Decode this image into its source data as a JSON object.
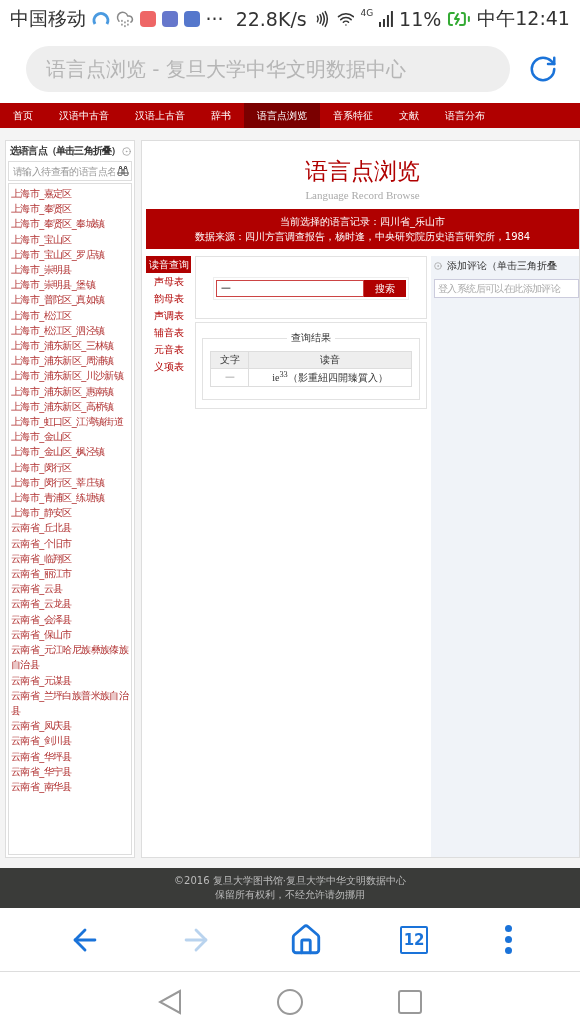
{
  "status_bar": {
    "carrier": "中国移动",
    "more": "···",
    "speed": "22.8K/s",
    "network": "4G",
    "battery": "11%",
    "time": "中午12:41"
  },
  "address_bar": {
    "title": "语言点浏览 - 复旦大学中华文明数据中心"
  },
  "nav": [
    {
      "label": "首页",
      "selected": false
    },
    {
      "label": "汉语中古音",
      "selected": false
    },
    {
      "label": "汉语上古音",
      "selected": false
    },
    {
      "label": "辞书",
      "selected": false
    },
    {
      "label": "语言点浏览",
      "selected": true
    },
    {
      "label": "音系特征",
      "selected": false
    },
    {
      "label": "文献",
      "selected": false
    },
    {
      "label": "语言分布",
      "selected": false
    }
  ],
  "sidebar": {
    "title": "选语言点（单击三角折叠）",
    "search_placeholder": "请输入待查看的语言点名",
    "items": [
      "上海市_嘉定区",
      "上海市_奉贤区",
      "上海市_奉贤区_奉城镇",
      "上海市_宝山区",
      "上海市_宝山区_罗店镇",
      "上海市_崇明县",
      "上海市_崇明县_堡镇",
      "上海市_普陀区_真如镇",
      "上海市_松江区",
      "上海市_松江区_泗泾镇",
      "上海市_浦东新区_三林镇",
      "上海市_浦东新区_周浦镇",
      "上海市_浦东新区_川沙新镇",
      "上海市_浦东新区_惠南镇",
      "上海市_浦东新区_高桥镇",
      "上海市_虹口区_江湾镇街道",
      "上海市_金山区",
      "上海市_金山区_枫泾镇",
      "上海市_闵行区",
      "上海市_闵行区_莘庄镇",
      "上海市_青浦区_练塘镇",
      "上海市_静安区",
      "云南省_丘北县",
      "云南省_个旧市",
      "云南省_临翔区",
      "云南省_丽江市",
      "云南省_云县",
      "云南省_云龙县",
      "云南省_会泽县",
      "云南省_保山市",
      "云南省_元江哈尼族彝族傣族自治县",
      "云南省_元谋县",
      "云南省_兰坪白族普米族自治县",
      "云南省_凤庆县",
      "云南省_剑川县",
      "云南省_华坪县",
      "云南省_华宁县",
      "云南省_南华县"
    ]
  },
  "header": {
    "title": "语言点浏览",
    "subtitle": "Language Record Browse",
    "current": "当前选择的语言记录：四川省_乐山市",
    "source": "数据来源：四川方言调查报告，杨时逢，中央研究院历史语言研究所，1984"
  },
  "menu": [
    {
      "label": "读音查询",
      "selected": true
    },
    {
      "label": "声母表",
      "selected": false
    },
    {
      "label": "韵母表",
      "selected": false
    },
    {
      "label": "声调表",
      "selected": false
    },
    {
      "label": "辅音表",
      "selected": false
    },
    {
      "label": "元音表",
      "selected": false
    },
    {
      "label": "义项表",
      "selected": false
    }
  ],
  "search": {
    "value": "一",
    "button": "搜索"
  },
  "results": {
    "legend": "查询结果",
    "columns": [
      "文字",
      "读音"
    ],
    "rows": [
      [
        "一",
        "ie$^{33}$（影重紐四開臻質入）"
      ]
    ]
  },
  "comments": {
    "title": "添加评论（单击三角折叠",
    "placeholder": "登入系统后可以在此添加评论"
  },
  "footer": {
    "lines": [
      "©2016 复旦大学图书馆·复旦大学中华文明数据中心",
      "保留所有权利，不经允许请勿挪用"
    ]
  },
  "browser_toolbar": {
    "back_disabled": false,
    "forward_disabled": true,
    "tabs": "12"
  }
}
